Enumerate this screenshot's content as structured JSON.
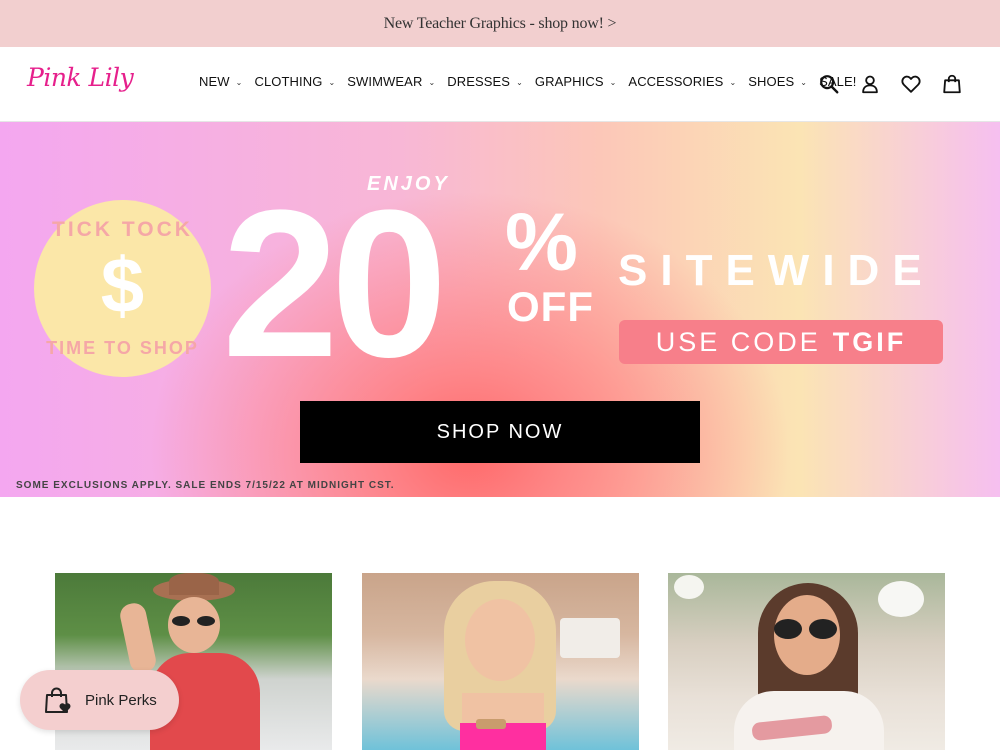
{
  "announcement": {
    "text": "New Teacher Graphics - shop now! >"
  },
  "header": {
    "logo": "Pink Lily",
    "nav": [
      {
        "label": "NEW",
        "dropdown": true
      },
      {
        "label": "CLOTHING",
        "dropdown": true
      },
      {
        "label": "SWIMWEAR",
        "dropdown": true
      },
      {
        "label": "DRESSES",
        "dropdown": true
      },
      {
        "label": "GRAPHICS",
        "dropdown": true
      },
      {
        "label": "ACCESSORIES",
        "dropdown": true
      },
      {
        "label": "SHOES",
        "dropdown": true
      },
      {
        "label": "SALE!",
        "dropdown": false
      }
    ],
    "icons": [
      "search-icon",
      "account-icon",
      "wishlist-heart-icon",
      "cart-bag-icon"
    ]
  },
  "hero": {
    "badge_top": "TICK TOCK",
    "badge_symbol": "$",
    "badge_bottom": "TIME TO SHOP",
    "enjoy": "ENJOY",
    "discount_number": "20",
    "percent_sign": "%",
    "off": "OFF",
    "sitewide": "SITEWIDE",
    "code_prefix": "USE CODE",
    "code": "TGIF",
    "cta": "SHOP NOW",
    "disclaimer": "SOME EXCLUSIONS APPLY. SALE ENDS 7/15/22 AT MIDNIGHT CST.",
    "colors": {
      "pill": "#f77f8a",
      "badge": "#fbe7a8",
      "button": "#000000"
    }
  },
  "products": [
    {
      "image": "woman-in-red-floral-dress-with-hat"
    },
    {
      "image": "woman-in-pink-swimsuit-by-pool"
    },
    {
      "image": "woman-in-teacher-graphic-tee"
    }
  ],
  "rewards": {
    "label": "Pink Perks",
    "icon": "shopping-bag-heart-icon"
  },
  "colors": {
    "announcement_bg": "#f2cfcf",
    "brand_pink": "#e6208c"
  }
}
